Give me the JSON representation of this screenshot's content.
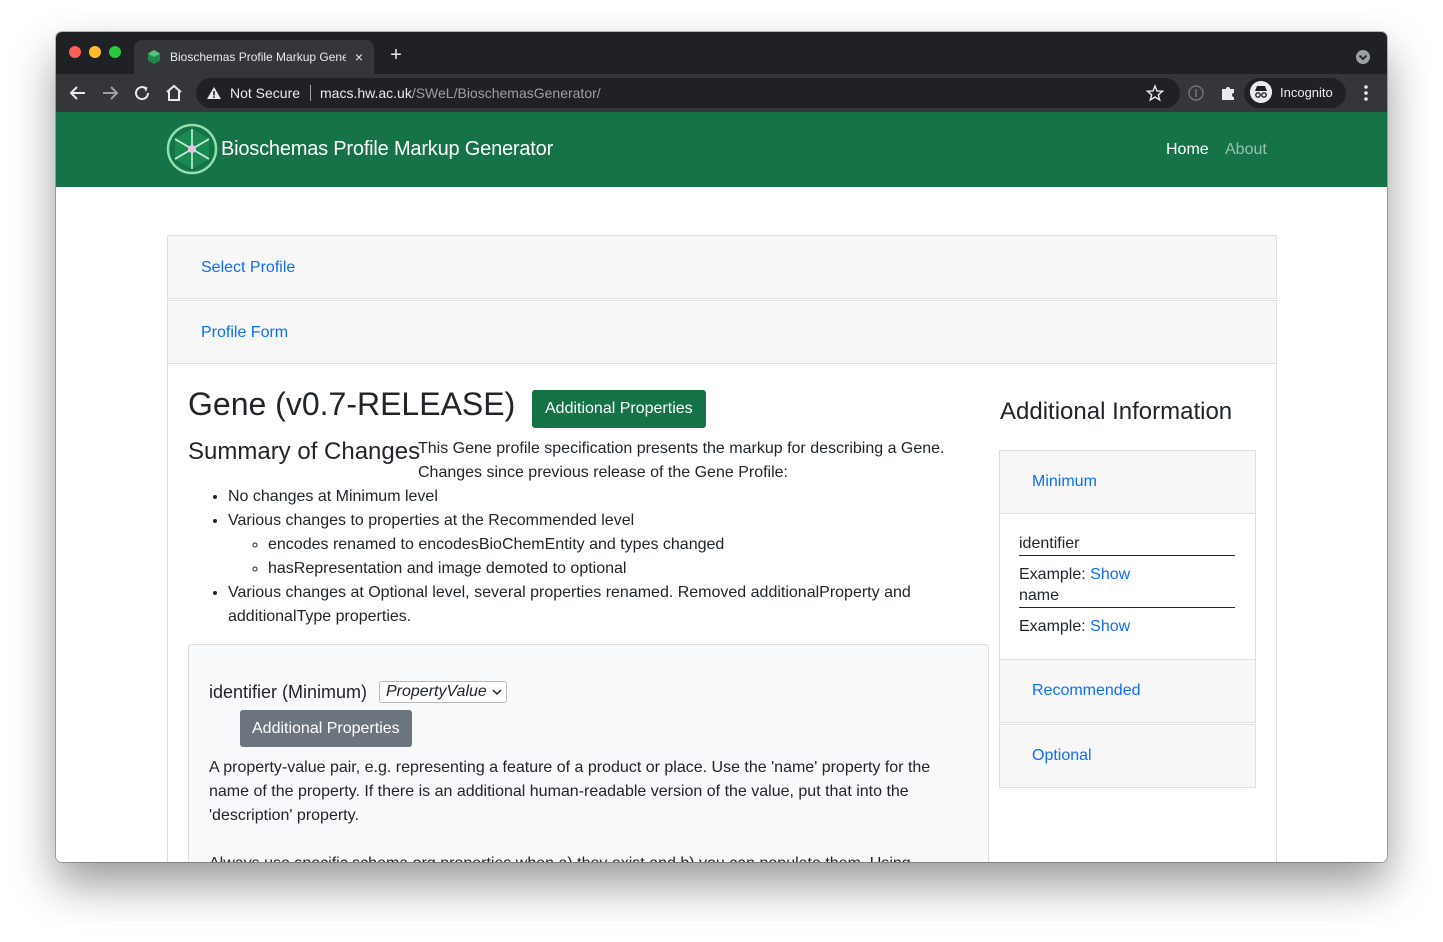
{
  "browser": {
    "tab_title": "Bioschemas Profile Markup Generator",
    "tab_close": "×",
    "new_tab": "+",
    "security_label": "Not Secure",
    "url_host": "macs.hw.ac.uk",
    "url_path": "/SWeL/BioschemasGenerator/",
    "incognito_label": "Incognito",
    "colors": {
      "frame": "#202124",
      "toolbar": "#35363a"
    }
  },
  "navbar": {
    "brand": "Bioschemas Profile Markup Generator",
    "home": "Home",
    "about": "About",
    "color": "#157347"
  },
  "steps": {
    "select_profile": "Select Profile",
    "profile_form": "Profile Form"
  },
  "profile": {
    "title": "Gene (v0.7-RELEASE)",
    "additional_properties_button": "Additional Properties",
    "summary_heading": "Summary of Changes",
    "summary_intro": "This Gene profile specification presents the markup for describing a Gene. Changes since previous release of the Gene Profile:",
    "changes": [
      "No changes at Minimum level",
      "Various changes to properties at the Recommended level",
      "Various changes at Optional level, several properties renamed. Removed additionalProperty and additionalType properties."
    ],
    "recommended_subchanges": [
      "encodes renamed to encodesBioChemEntity and types changed",
      "hasRepresentation and image demoted to optional"
    ]
  },
  "property": {
    "title": "identifier (Minimum)",
    "type_selected": "PropertyValue",
    "button": "Additional Properties",
    "description": "A property-value pair, e.g. representing a feature of a product or place. Use the 'name' property for the name of the property. If there is an additional human-readable version of the value, put that into the 'description' property.",
    "description_more": "Always use specific schema.org properties when a) they exist and b) you can populate them. Using"
  },
  "sidebar": {
    "title": "Additional Information",
    "minimum": "Minimum",
    "recommended": "Recommended",
    "optional": "Optional",
    "fields": [
      {
        "name": "identifier",
        "example_label": "Example:",
        "example_link": "Show"
      },
      {
        "name": "name",
        "example_label": "Example:",
        "example_link": "Show"
      }
    ]
  }
}
